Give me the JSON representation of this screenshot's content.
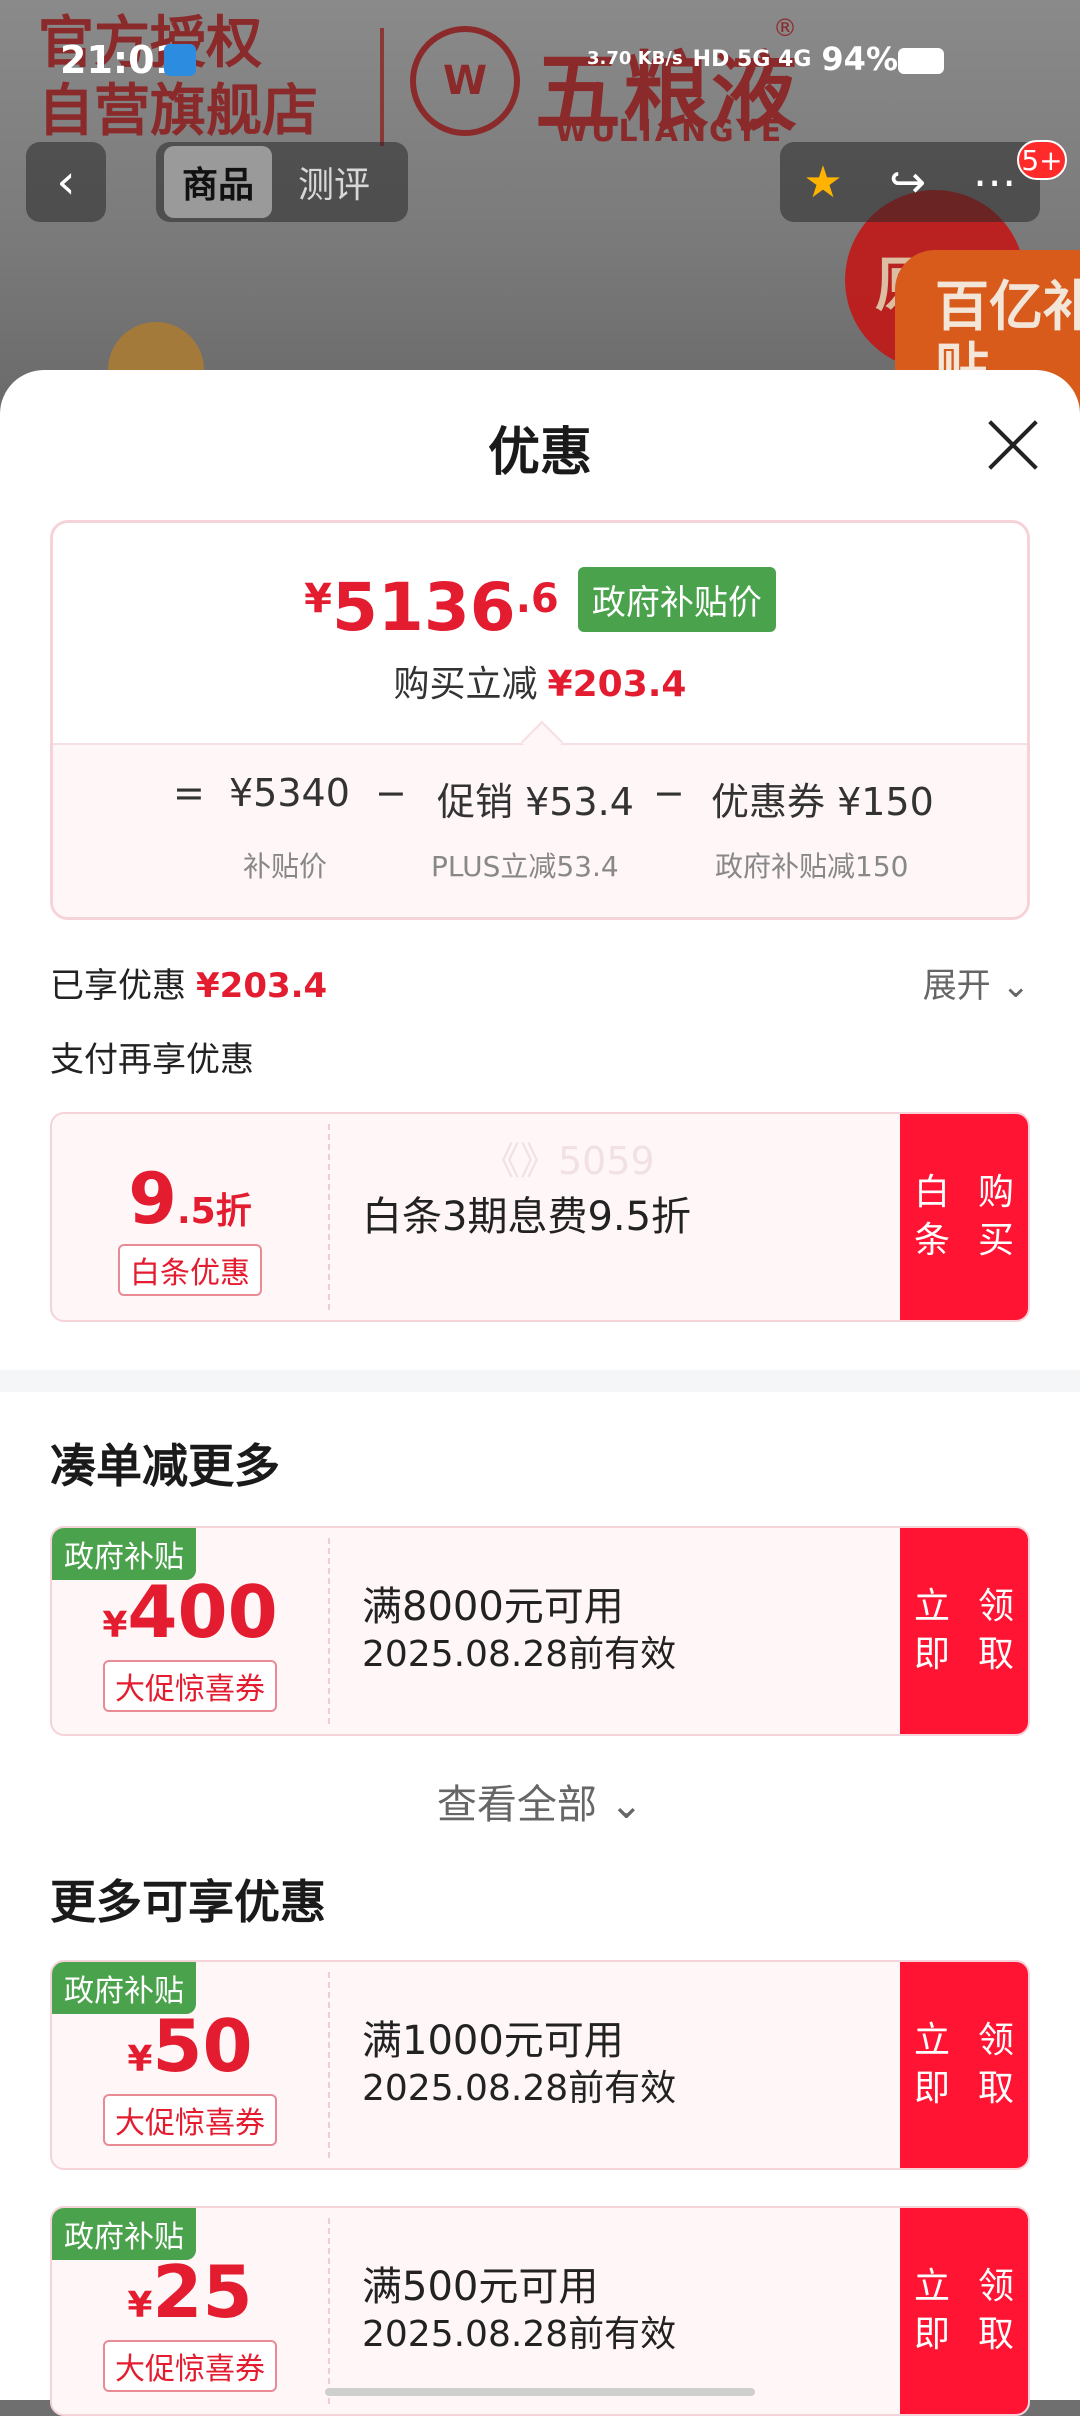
{
  "status_bar": {
    "time": "21:01",
    "net_speed": "3.70 KB/s",
    "indicators": "HD 5G 4G",
    "battery": "94%"
  },
  "background": {
    "store_line1": "官方授权",
    "store_line2": "自营旗舰店",
    "brand_cn": "五粮液",
    "brand_en": "WULIANGYE",
    "brand_seal": "W",
    "brand_reg": "®",
    "badge_red": "原箱",
    "badge_orange": "百亿补贴"
  },
  "nav": {
    "back_icon": "chevron-left",
    "tabs": [
      {
        "label": "商品",
        "active": true
      },
      {
        "label": "测评",
        "active": false
      }
    ],
    "favorite_icon": "star",
    "share_icon": "share",
    "more_icon": "more",
    "message_badge": "5+"
  },
  "sheet": {
    "title": "优惠",
    "price": {
      "currency": "¥",
      "integer": "5136",
      "decimal": ".6",
      "tag": "政府补贴价",
      "reduce_label": "购买立减",
      "reduce_value": "¥203.4"
    },
    "formula": {
      "equals": "=",
      "base_value": "¥5340",
      "base_label": "补贴价",
      "minus1": "−",
      "promo_value": "促销 ¥53.4",
      "promo_label": "PLUS立减53.4",
      "minus2": "−",
      "coupon_value": "优惠券 ¥150",
      "coupon_label": "政府补贴减150"
    },
    "enjoyed_label": "已享优惠",
    "enjoyed_value": "¥203.4",
    "expand_label": "展开",
    "pay_again_label": "支付再享优惠",
    "baitiao": {
      "value_big": "9",
      "value_small": ".5折",
      "label": "白条优惠",
      "desc": "白条3期息费9.5折",
      "watermark": "《》5059",
      "button": "白条 购买"
    },
    "section_more_title": "凑单减更多",
    "coupons_main": [
      {
        "tag": "政府补贴",
        "currency": "¥",
        "amount": "400",
        "label": "大促惊喜券",
        "condition": "满8000元可用",
        "validity": "2025.08.28前有效",
        "button": "立即 领取"
      }
    ],
    "view_all": "查看全部",
    "section_extra_title": "更多可享优惠",
    "coupons_extra": [
      {
        "tag": "政府补贴",
        "currency": "¥",
        "amount": "50",
        "label": "大促惊喜券",
        "condition": "满1000元可用",
        "validity": "2025.08.28前有效",
        "button": "立即 领取"
      },
      {
        "tag": "政府补贴",
        "currency": "¥",
        "amount": "25",
        "label": "大促惊喜券",
        "condition": "满500元可用",
        "validity": "2025.08.28前有效",
        "button": "立即 领取"
      }
    ]
  },
  "colors": {
    "accent_red": "#e41c2f",
    "button_red": "#ff1533",
    "gov_green": "#4aa24c"
  }
}
